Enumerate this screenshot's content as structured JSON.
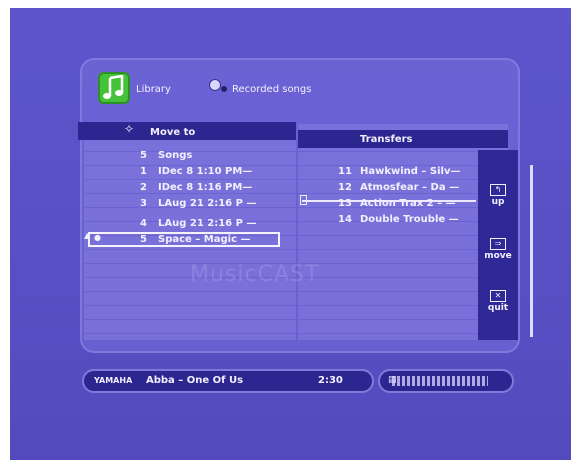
{
  "header": {
    "library_label": "Library",
    "recorded_label": "Recorded songs"
  },
  "left_list": {
    "header": "Move to",
    "rows": [
      {
        "num": "5",
        "text": "Songs"
      },
      {
        "num": "1",
        "text": "IDec  8  1:10 PM—"
      },
      {
        "num": "2",
        "text": "IDec  8  1:16 PM—"
      },
      {
        "num": "3",
        "text": "LAug 21  2:16 P  —"
      },
      {
        "num": "4",
        "text": "LAug 21  2:16 P  —"
      },
      {
        "num": "5",
        "text": "Space – Magic  —"
      }
    ],
    "selected_index": 5
  },
  "right_list": {
    "header": "Transfers",
    "rows": [
      {
        "num": "11",
        "text": "Hawkwind – Silv—"
      },
      {
        "num": "12",
        "text": "Atmosfear – Da —"
      },
      {
        "num": "13",
        "text": "Action Trax 2 – —"
      },
      {
        "num": "14",
        "text": "Double Trouble  —"
      }
    ]
  },
  "side_buttons": {
    "up": "up",
    "move": "move",
    "quit": "quit"
  },
  "watermark": "MusicCAST",
  "status": {
    "brand": "YAMAHA",
    "now_playing": "Abba – One Of Us",
    "time": "2:30"
  },
  "colors": {
    "background": "#5a52c8",
    "header_bar": "#2c2690",
    "text": "#f2f0ff",
    "logo_green": "#46c23a"
  }
}
